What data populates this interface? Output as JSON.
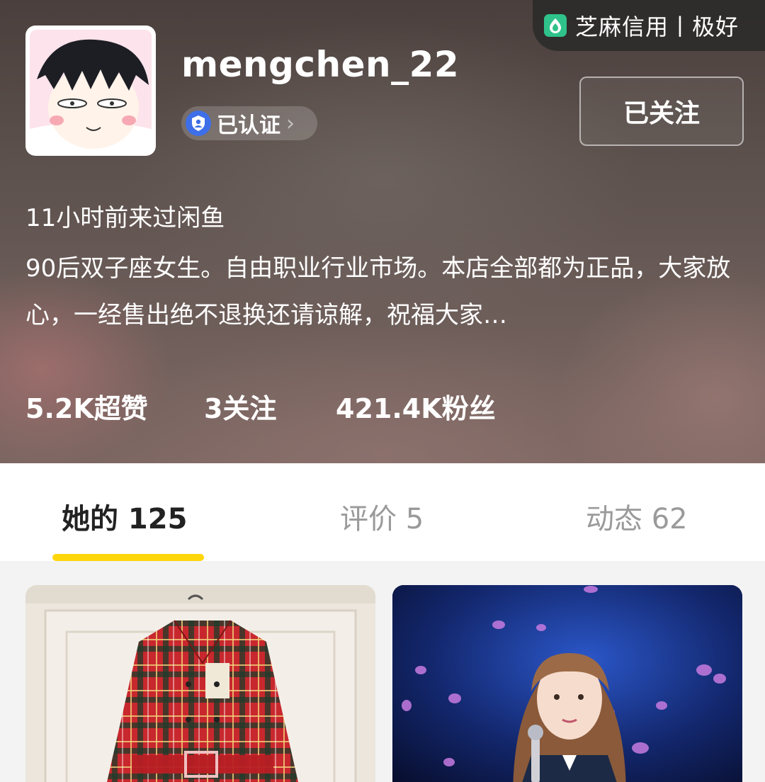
{
  "credit": {
    "icon": "sesame-credit-icon",
    "text": "芝麻信用丨极好"
  },
  "profile": {
    "username": "mengchen_22",
    "verified_label": "已认证",
    "follow_button": "已关注",
    "last_seen": "11小时前来过闲鱼",
    "bio": "90后双子座女生。自由职业行业市场。本店全部都为正品，大家放心，一经售出绝不退换还请谅解，祝福大家…"
  },
  "stats": {
    "likes": "5.2K超赞",
    "following": "3关注",
    "followers": "421.4K粉丝"
  },
  "tabs": [
    {
      "label": "她的 125",
      "active": true
    },
    {
      "label": "评价 5",
      "active": false
    },
    {
      "label": "动态 62",
      "active": false
    }
  ],
  "colors": {
    "accent": "#ffd60a",
    "verified": "#3e6fe8",
    "credit": "#2fc28a"
  }
}
